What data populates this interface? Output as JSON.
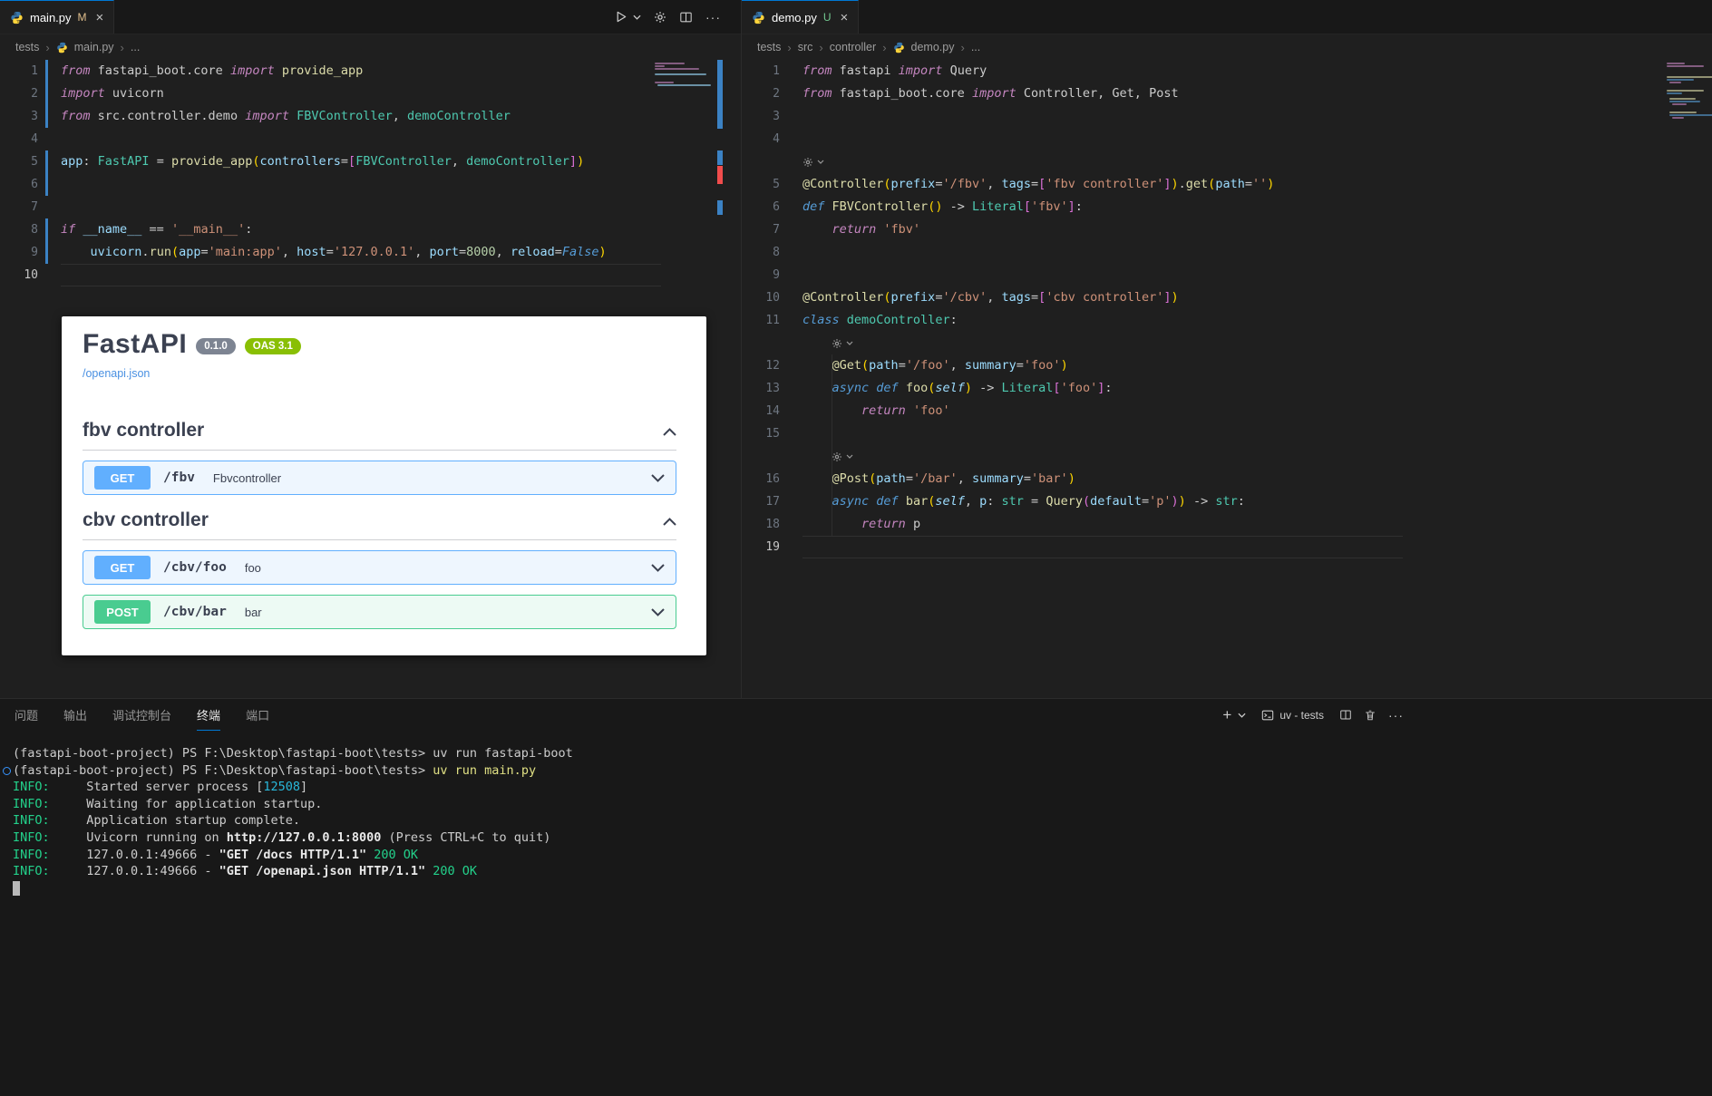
{
  "left_editor": {
    "tab": {
      "label": "main.py",
      "git": "M"
    },
    "breadcrumb": [
      "tests",
      "main.py",
      "..."
    ],
    "current_line": 10,
    "changed_lines": [
      1,
      2,
      3,
      5,
      6,
      8,
      9
    ],
    "rows": [
      {
        "n": 1,
        "t": [
          [
            "from ",
            "kw"
          ],
          [
            "fastapi_boot.core ",
            "pl"
          ],
          [
            "import ",
            "kw"
          ],
          [
            "provide_app",
            "fn"
          ]
        ]
      },
      {
        "n": 2,
        "t": [
          [
            "import ",
            "kw"
          ],
          [
            "uvicorn",
            "pl"
          ]
        ]
      },
      {
        "n": 3,
        "t": [
          [
            "from ",
            "kw"
          ],
          [
            "src.controller.demo ",
            "pl"
          ],
          [
            "import ",
            "kw"
          ],
          [
            "FBVController",
            "cls"
          ],
          [
            ", ",
            "pl"
          ],
          [
            "demoController",
            "cls"
          ]
        ]
      },
      {
        "n": 4,
        "t": []
      },
      {
        "n": 5,
        "t": [
          [
            "app",
            "var"
          ],
          [
            ": ",
            "pl"
          ],
          [
            "FastAPI",
            "cls"
          ],
          [
            " = ",
            "pl"
          ],
          [
            "provide_app",
            "fn"
          ],
          [
            "(",
            "b1"
          ],
          [
            "controllers",
            "var"
          ],
          [
            "=",
            "pl"
          ],
          [
            "[",
            "b2"
          ],
          [
            "FBVController",
            "cls"
          ],
          [
            ", ",
            "pl"
          ],
          [
            "demoController",
            "cls"
          ],
          [
            "]",
            "b2"
          ],
          [
            ")",
            "b1"
          ]
        ]
      },
      {
        "n": 6,
        "t": []
      },
      {
        "n": 7,
        "t": []
      },
      {
        "n": 8,
        "t": [
          [
            "if ",
            "kw"
          ],
          [
            "__name__",
            "var"
          ],
          [
            " == ",
            "pl"
          ],
          [
            "'__main__'",
            "str"
          ],
          [
            ":",
            "pl"
          ]
        ]
      },
      {
        "n": 9,
        "t": [
          [
            "    ",
            "pl"
          ],
          [
            "uvicorn",
            "var"
          ],
          [
            ".",
            "pl"
          ],
          [
            "run",
            "fn"
          ],
          [
            "(",
            "b1"
          ],
          [
            "app",
            "var"
          ],
          [
            "=",
            "pl"
          ],
          [
            "'main:app'",
            "str"
          ],
          [
            ", ",
            "pl"
          ],
          [
            "host",
            "var"
          ],
          [
            "=",
            "pl"
          ],
          [
            "'127.0.0.1'",
            "str"
          ],
          [
            ", ",
            "pl"
          ],
          [
            "port",
            "var"
          ],
          [
            "=",
            "pl"
          ],
          [
            "8000",
            "num"
          ],
          [
            ", ",
            "pl"
          ],
          [
            "reload",
            "var"
          ],
          [
            "=",
            "pl"
          ],
          [
            "False",
            "kb"
          ],
          [
            ")",
            "b1"
          ]
        ]
      },
      {
        "n": 10,
        "t": []
      }
    ]
  },
  "right_editor": {
    "tab": {
      "label": "demo.py",
      "git": "U"
    },
    "breadcrumb": [
      "tests",
      "src",
      "controller",
      "demo.py",
      "..."
    ],
    "current_line": 19,
    "changed_lines": [],
    "rows": [
      {
        "n": 1,
        "t": [
          [
            "from ",
            "kw"
          ],
          [
            "fastapi ",
            "pl"
          ],
          [
            "import ",
            "kw"
          ],
          [
            "Query",
            "pl"
          ]
        ]
      },
      {
        "n": 2,
        "t": [
          [
            "from ",
            "kw"
          ],
          [
            "fastapi_boot.core ",
            "pl"
          ],
          [
            "import ",
            "kw"
          ],
          [
            "Controller",
            "pl"
          ],
          [
            ", ",
            "pl"
          ],
          [
            "Get",
            "pl"
          ],
          [
            ", ",
            "pl"
          ],
          [
            "Post",
            "pl"
          ]
        ]
      },
      {
        "n": 3,
        "t": []
      },
      {
        "n": 4,
        "t": []
      },
      {
        "gear": true,
        "pad": 0
      },
      {
        "n": 5,
        "t": [
          [
            "@Controller",
            "fn"
          ],
          [
            "(",
            "b1"
          ],
          [
            "prefix",
            "var"
          ],
          [
            "=",
            "pl"
          ],
          [
            "'/fbv'",
            "str"
          ],
          [
            ", ",
            "pl"
          ],
          [
            "tags",
            "var"
          ],
          [
            "=",
            "pl"
          ],
          [
            "[",
            "b2"
          ],
          [
            "'fbv controller'",
            "str"
          ],
          [
            "]",
            "b2"
          ],
          [
            ")",
            "b1"
          ],
          [
            ".",
            "pl"
          ],
          [
            "get",
            "fn"
          ],
          [
            "(",
            "b1"
          ],
          [
            "path",
            "var"
          ],
          [
            "=",
            "pl"
          ],
          [
            "''",
            "str"
          ],
          [
            ")",
            "b1"
          ]
        ]
      },
      {
        "n": 6,
        "t": [
          [
            "def ",
            "kb"
          ],
          [
            "FBVController",
            "fn"
          ],
          [
            "()",
            "b1"
          ],
          [
            " -> ",
            "pl"
          ],
          [
            "Literal",
            "cls"
          ],
          [
            "[",
            "b2"
          ],
          [
            "'fbv'",
            "str"
          ],
          [
            "]",
            "b2"
          ],
          [
            ":",
            "pl"
          ]
        ]
      },
      {
        "n": 7,
        "t": [
          [
            "    ",
            "pl"
          ],
          [
            "return ",
            "kw"
          ],
          [
            "'fbv'",
            "str"
          ]
        ]
      },
      {
        "n": 8,
        "t": []
      },
      {
        "n": 9,
        "t": []
      },
      {
        "n": 10,
        "t": [
          [
            "@Controller",
            "fn"
          ],
          [
            "(",
            "b1"
          ],
          [
            "prefix",
            "var"
          ],
          [
            "=",
            "pl"
          ],
          [
            "'/cbv'",
            "str"
          ],
          [
            ", ",
            "pl"
          ],
          [
            "tags",
            "var"
          ],
          [
            "=",
            "pl"
          ],
          [
            "[",
            "b2"
          ],
          [
            "'cbv controller'",
            "str"
          ],
          [
            "]",
            "b2"
          ],
          [
            ")",
            "b1"
          ]
        ]
      },
      {
        "n": 11,
        "t": [
          [
            "class ",
            "kb"
          ],
          [
            "demoController",
            "cls"
          ],
          [
            ":",
            "pl"
          ]
        ]
      },
      {
        "gear": true,
        "pad": 4
      },
      {
        "n": 12,
        "t": [
          [
            "    ",
            "pl"
          ],
          [
            "@Get",
            "fn"
          ],
          [
            "(",
            "b1"
          ],
          [
            "path",
            "var"
          ],
          [
            "=",
            "pl"
          ],
          [
            "'/foo'",
            "str"
          ],
          [
            ", ",
            "pl"
          ],
          [
            "summary",
            "var"
          ],
          [
            "=",
            "pl"
          ],
          [
            "'foo'",
            "str"
          ],
          [
            ")",
            "b1"
          ]
        ]
      },
      {
        "n": 13,
        "t": [
          [
            "    ",
            "pl"
          ],
          [
            "async ",
            "kb"
          ],
          [
            "def ",
            "kb"
          ],
          [
            "foo",
            "fn"
          ],
          [
            "(",
            "b1"
          ],
          [
            "self",
            "selfp"
          ],
          [
            ")",
            "b1"
          ],
          [
            " -> ",
            "pl"
          ],
          [
            "Literal",
            "cls"
          ],
          [
            "[",
            "b2"
          ],
          [
            "'foo'",
            "str"
          ],
          [
            "]",
            "b2"
          ],
          [
            ":",
            "pl"
          ]
        ]
      },
      {
        "n": 14,
        "t": [
          [
            "        ",
            "pl"
          ],
          [
            "return ",
            "kw"
          ],
          [
            "'foo'",
            "str"
          ]
        ]
      },
      {
        "n": 15,
        "t": []
      },
      {
        "gear": true,
        "pad": 4
      },
      {
        "n": 16,
        "t": [
          [
            "    ",
            "pl"
          ],
          [
            "@Post",
            "fn"
          ],
          [
            "(",
            "b1"
          ],
          [
            "path",
            "var"
          ],
          [
            "=",
            "pl"
          ],
          [
            "'/bar'",
            "str"
          ],
          [
            ", ",
            "pl"
          ],
          [
            "summary",
            "var"
          ],
          [
            "=",
            "pl"
          ],
          [
            "'bar'",
            "str"
          ],
          [
            ")",
            "b1"
          ]
        ]
      },
      {
        "n": 17,
        "t": [
          [
            "    ",
            "pl"
          ],
          [
            "async ",
            "kb"
          ],
          [
            "def ",
            "kb"
          ],
          [
            "bar",
            "fn"
          ],
          [
            "(",
            "b1"
          ],
          [
            "self",
            "selfp"
          ],
          [
            ", ",
            "pl"
          ],
          [
            "p",
            "var"
          ],
          [
            ": ",
            "pl"
          ],
          [
            "str",
            "cls"
          ],
          [
            " = ",
            "pl"
          ],
          [
            "Query",
            "fn"
          ],
          [
            "(",
            "b2"
          ],
          [
            "default",
            "var"
          ],
          [
            "=",
            "pl"
          ],
          [
            "'p'",
            "str"
          ],
          [
            ")",
            "b2"
          ],
          [
            ")",
            "b1"
          ],
          [
            " -> ",
            "pl"
          ],
          [
            "str",
            "cls"
          ],
          [
            ":",
            "pl"
          ]
        ]
      },
      {
        "n": 18,
        "t": [
          [
            "        ",
            "pl"
          ],
          [
            "return ",
            "kw"
          ],
          [
            "p",
            "pl"
          ]
        ]
      },
      {
        "n": 19,
        "t": []
      }
    ]
  },
  "swagger": {
    "title": "FastAPI",
    "version_badge": "0.1.0",
    "oas_badge": "OAS 3.1",
    "spec_link": "/openapi.json",
    "sections": [
      {
        "name": "fbv controller",
        "routes": [
          {
            "method": "GET",
            "path": "/fbv",
            "desc": "Fbvcontroller",
            "color": "blue"
          }
        ]
      },
      {
        "name": "cbv controller",
        "routes": [
          {
            "method": "GET",
            "path": "/cbv/foo",
            "desc": "foo",
            "color": "blue"
          },
          {
            "method": "POST",
            "path": "/cbv/bar",
            "desc": "bar",
            "color": "green"
          }
        ]
      }
    ]
  },
  "panel": {
    "tabs": [
      "问题",
      "输出",
      "调试控制台",
      "终端",
      "端口"
    ],
    "active_tab": "终端",
    "terminal_name": "uv - tests",
    "terminal_lines": [
      {
        "t": [
          [
            "(fastapi-boot-project) PS F:\\Desktop\\fastapi-boot\\tests> uv run fastapi-boot",
            "w"
          ]
        ]
      },
      {
        "circle": true,
        "t": [
          [
            "(fastapi-boot-project) PS F:\\Desktop\\fastapi-boot\\tests> ",
            "w"
          ],
          [
            "uv run main.py",
            "y"
          ]
        ]
      },
      {
        "t": [
          [
            "INFO:",
            "g"
          ],
          [
            "     Started server process [",
            "w"
          ],
          [
            "12508",
            "c"
          ],
          [
            "]",
            "w"
          ]
        ]
      },
      {
        "t": [
          [
            "INFO:",
            "g"
          ],
          [
            "     Waiting for application startup.",
            "w"
          ]
        ]
      },
      {
        "t": [
          [
            "INFO:",
            "g"
          ],
          [
            "     Application startup complete.",
            "w"
          ]
        ]
      },
      {
        "t": [
          [
            "INFO:",
            "g"
          ],
          [
            "     Uvicorn running on ",
            "w"
          ],
          [
            "http://127.0.0.1:8000",
            "wb"
          ],
          [
            " (Press CTRL+C to quit)",
            "w"
          ]
        ]
      },
      {
        "t": [
          [
            "INFO:",
            "g"
          ],
          [
            "     127.0.0.1:49666 - ",
            "w"
          ],
          [
            "\"GET /docs HTTP/1.1\" ",
            "wb"
          ],
          [
            "200 OK",
            "g"
          ]
        ]
      },
      {
        "t": [
          [
            "INFO:",
            "g"
          ],
          [
            "     127.0.0.1:49666 - ",
            "w"
          ],
          [
            "\"GET /openapi.json HTTP/1.1\" ",
            "wb"
          ],
          [
            "200 OK",
            "g"
          ]
        ]
      },
      {
        "cursor": true,
        "t": []
      }
    ]
  },
  "colors": {
    "accent": "#0078d4",
    "get_method": "#61affe",
    "post_method": "#49cc90",
    "git_modified": "#e2c08d",
    "git_untracked": "#73c991",
    "oas_badge": "#89bf04",
    "version_badge": "#7d8492"
  }
}
